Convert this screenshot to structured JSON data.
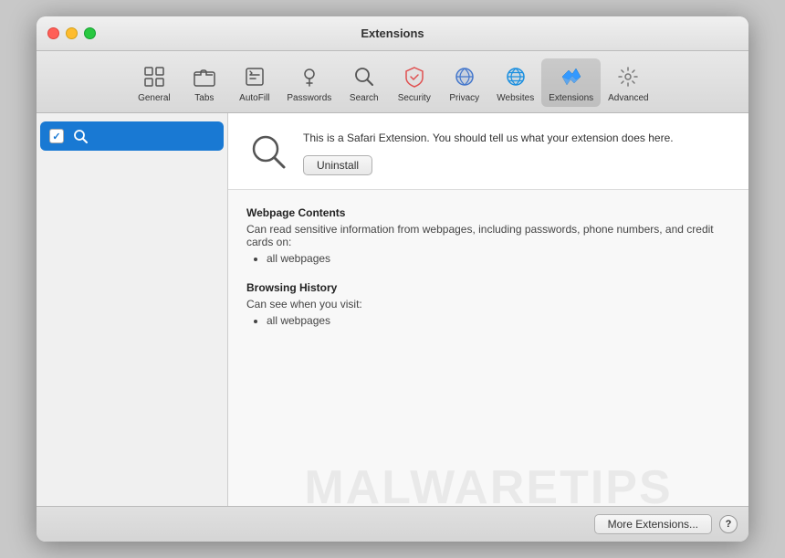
{
  "window": {
    "title": "Extensions"
  },
  "toolbar": {
    "items": [
      {
        "id": "general",
        "label": "General",
        "icon": "general-icon"
      },
      {
        "id": "tabs",
        "label": "Tabs",
        "icon": "tabs-icon"
      },
      {
        "id": "autofill",
        "label": "AutoFill",
        "icon": "autofill-icon"
      },
      {
        "id": "passwords",
        "label": "Passwords",
        "icon": "passwords-icon"
      },
      {
        "id": "search",
        "label": "Search",
        "icon": "search-icon"
      },
      {
        "id": "security",
        "label": "Security",
        "icon": "security-icon"
      },
      {
        "id": "privacy",
        "label": "Privacy",
        "icon": "privacy-icon"
      },
      {
        "id": "websites",
        "label": "Websites",
        "icon": "websites-icon"
      },
      {
        "id": "extensions",
        "label": "Extensions",
        "icon": "extensions-icon",
        "active": true
      },
      {
        "id": "advanced",
        "label": "Advanced",
        "icon": "advanced-icon"
      }
    ]
  },
  "sidebar": {
    "items": [
      {
        "id": "search-ext",
        "label": "",
        "checked": true,
        "selected": true
      }
    ]
  },
  "detail": {
    "description": "This is a Safari Extension. You should tell us what your extension does here.",
    "uninstall_label": "Uninstall",
    "permissions": [
      {
        "title": "Webpage Contents",
        "description": "Can read sensitive information from webpages, including passwords, phone numbers, and credit cards on:",
        "items": [
          "all webpages"
        ]
      },
      {
        "title": "Browsing History",
        "description": "Can see when you visit:",
        "items": [
          "all webpages"
        ]
      }
    ]
  },
  "bottom_bar": {
    "more_extensions_label": "More Extensions...",
    "help_label": "?"
  },
  "watermark": "MALWARETIPS"
}
